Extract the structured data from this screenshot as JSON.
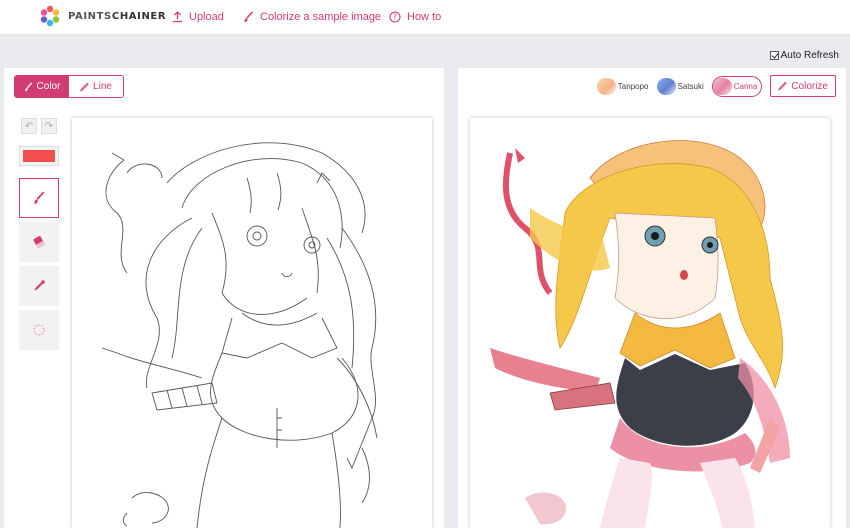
{
  "header": {
    "logo_text_a": "PAINTS",
    "logo_text_b": "CHAINER",
    "nav": [
      {
        "label": "Upload",
        "icon": "upload-icon"
      },
      {
        "label": "Colorize a sample image",
        "icon": "brush-icon"
      },
      {
        "label": "How to",
        "icon": "help-circle-icon"
      }
    ]
  },
  "options": {
    "auto_refresh_label": "Auto Refresh",
    "auto_refresh_checked": true
  },
  "left": {
    "modes": [
      {
        "label": "Color",
        "active": true
      },
      {
        "label": "Line",
        "active": false
      }
    ],
    "current_color": "#f34e4e",
    "tools": [
      "brush-icon",
      "eraser-icon",
      "eyedropper-icon",
      "loading-icon"
    ]
  },
  "right": {
    "styles": [
      {
        "label": "Tanpopo",
        "selected": false
      },
      {
        "label": "Satsuki",
        "selected": false
      },
      {
        "label": "Canna",
        "selected": true
      }
    ],
    "colorize_label": "Colorize"
  },
  "colors": {
    "accent": "#d23b73",
    "background": "#e9ebee"
  }
}
